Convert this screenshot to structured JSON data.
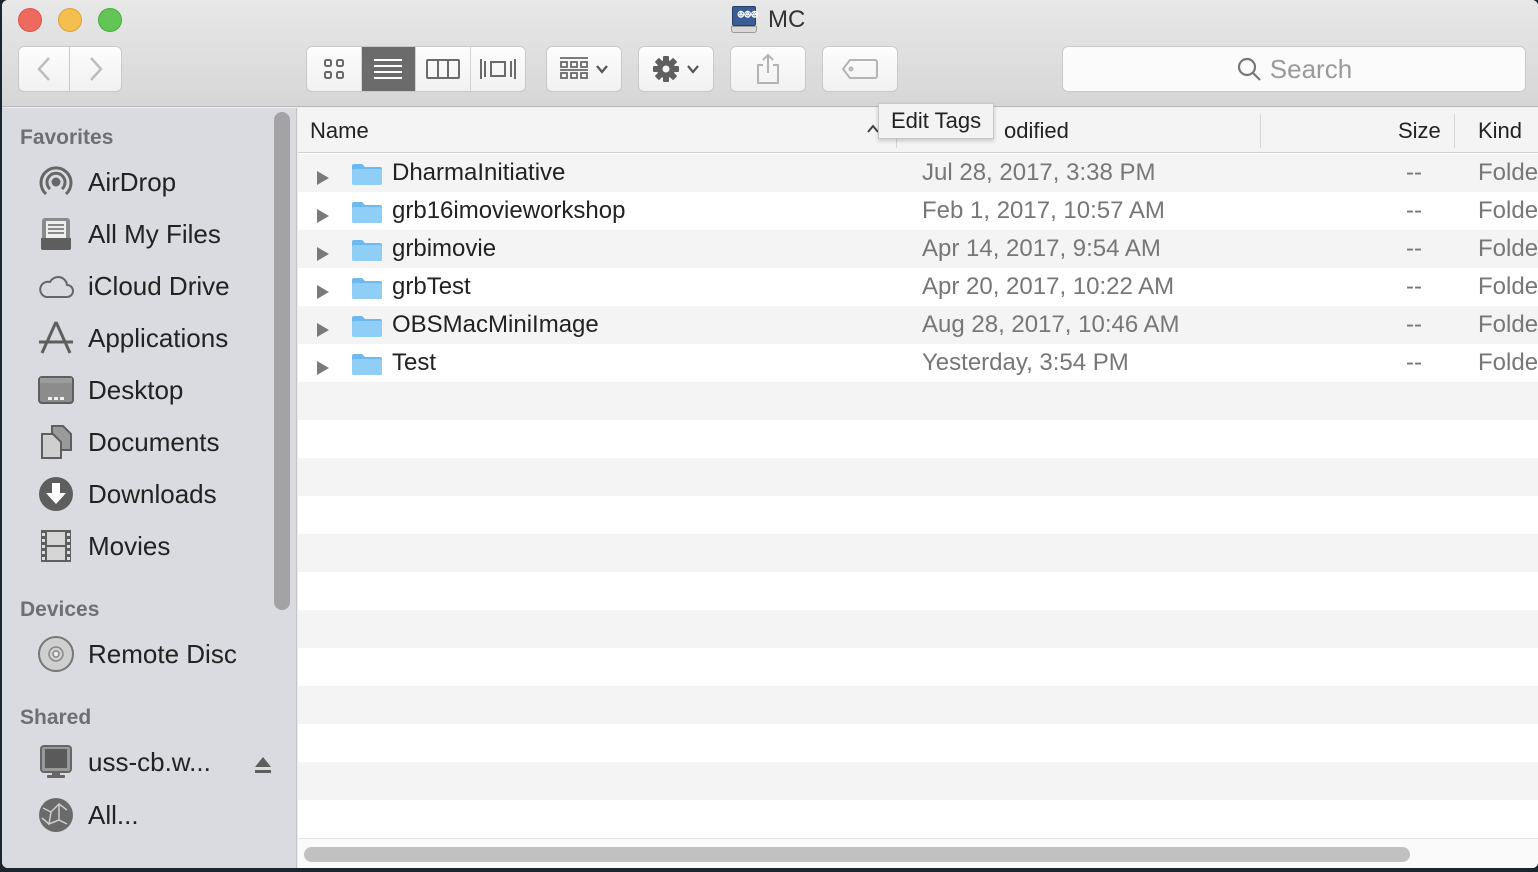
{
  "window": {
    "title": "MC",
    "title_icon": "network-drive-icon"
  },
  "toolbar": {
    "back_icon": "chevron-left-icon",
    "forward_icon": "chevron-right-icon",
    "view_modes": [
      {
        "name": "icon-view",
        "icon": "grid-icon",
        "active": false
      },
      {
        "name": "list-view",
        "icon": "list-icon",
        "active": true
      },
      {
        "name": "column-view",
        "icon": "columns-icon",
        "active": false
      },
      {
        "name": "cover-flow-view",
        "icon": "cover-flow-icon",
        "active": false
      }
    ],
    "arrange_icon": "arrange-grid-icon",
    "action_icon": "gear-icon",
    "share_icon": "share-icon",
    "tags_icon": "tag-icon",
    "search_placeholder": "Search"
  },
  "tooltip": {
    "text": "Edit Tags"
  },
  "sidebar": {
    "sections": [
      {
        "title": "Favorites",
        "items": [
          {
            "label": "AirDrop",
            "icon": "airdrop-icon"
          },
          {
            "label": "All My Files",
            "icon": "all-my-files-icon"
          },
          {
            "label": "iCloud Drive",
            "icon": "cloud-icon"
          },
          {
            "label": "Applications",
            "icon": "applications-icon"
          },
          {
            "label": "Desktop",
            "icon": "desktop-icon"
          },
          {
            "label": "Documents",
            "icon": "documents-icon"
          },
          {
            "label": "Downloads",
            "icon": "downloads-icon"
          },
          {
            "label": "Movies",
            "icon": "film-icon"
          }
        ]
      },
      {
        "title": "Devices",
        "items": [
          {
            "label": "Remote Disc",
            "icon": "disc-icon"
          }
        ]
      },
      {
        "title": "Shared",
        "items": [
          {
            "label": "uss-cb.w...",
            "icon": "monitor-icon",
            "eject": true
          },
          {
            "label": "All...",
            "icon": "network-globe-icon"
          }
        ]
      }
    ]
  },
  "list": {
    "columns": {
      "name": "Name",
      "date_modified": "Date Modified",
      "date_modified_visible": "odified",
      "size": "Size",
      "kind": "Kind"
    },
    "sort": {
      "column": "name",
      "direction": "ascending"
    },
    "rows": [
      {
        "name": "DharmaInitiative",
        "date": "Jul 28, 2017, 3:38 PM",
        "size": "--",
        "kind": "Folder"
      },
      {
        "name": "grb16imovieworkshop",
        "date": "Feb 1, 2017, 10:57 AM",
        "size": "--",
        "kind": "Folder"
      },
      {
        "name": "grbimovie",
        "date": "Apr 14, 2017, 9:54 AM",
        "size": "--",
        "kind": "Folder"
      },
      {
        "name": "grbTest",
        "date": "Apr 20, 2017, 10:22 AM",
        "size": "--",
        "kind": "Folder"
      },
      {
        "name": "OBSMacMiniImage",
        "date": "Aug 28, 2017, 10:46 AM",
        "size": "--",
        "kind": "Folder"
      },
      {
        "name": "Test",
        "date": "Yesterday, 3:54 PM",
        "size": "--",
        "kind": "Folder"
      }
    ]
  },
  "colors": {
    "folder_blue": "#7cc4f4",
    "active_segment": "#6b6b6b",
    "sidebar_bg": "#d9dbe0",
    "row_stripe": "#f4f4f4"
  }
}
